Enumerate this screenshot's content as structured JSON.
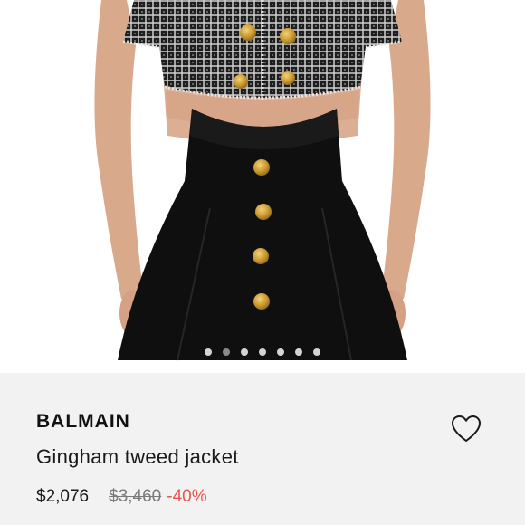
{
  "product": {
    "brand": "BALMAIN",
    "name": "Gingham tweed jacket",
    "price_current": "$2,076",
    "price_original": "$3,460",
    "discount": "-40%"
  },
  "carousel": {
    "dot_count": 7,
    "active_index": 1
  },
  "icons": {
    "wishlist": "heart-outline-icon"
  },
  "colors": {
    "discount": "#e8554e",
    "panel_background": "#f2f2f2",
    "dot_active": "#8a8a8a",
    "dot_inactive": "#d4d4d4"
  }
}
